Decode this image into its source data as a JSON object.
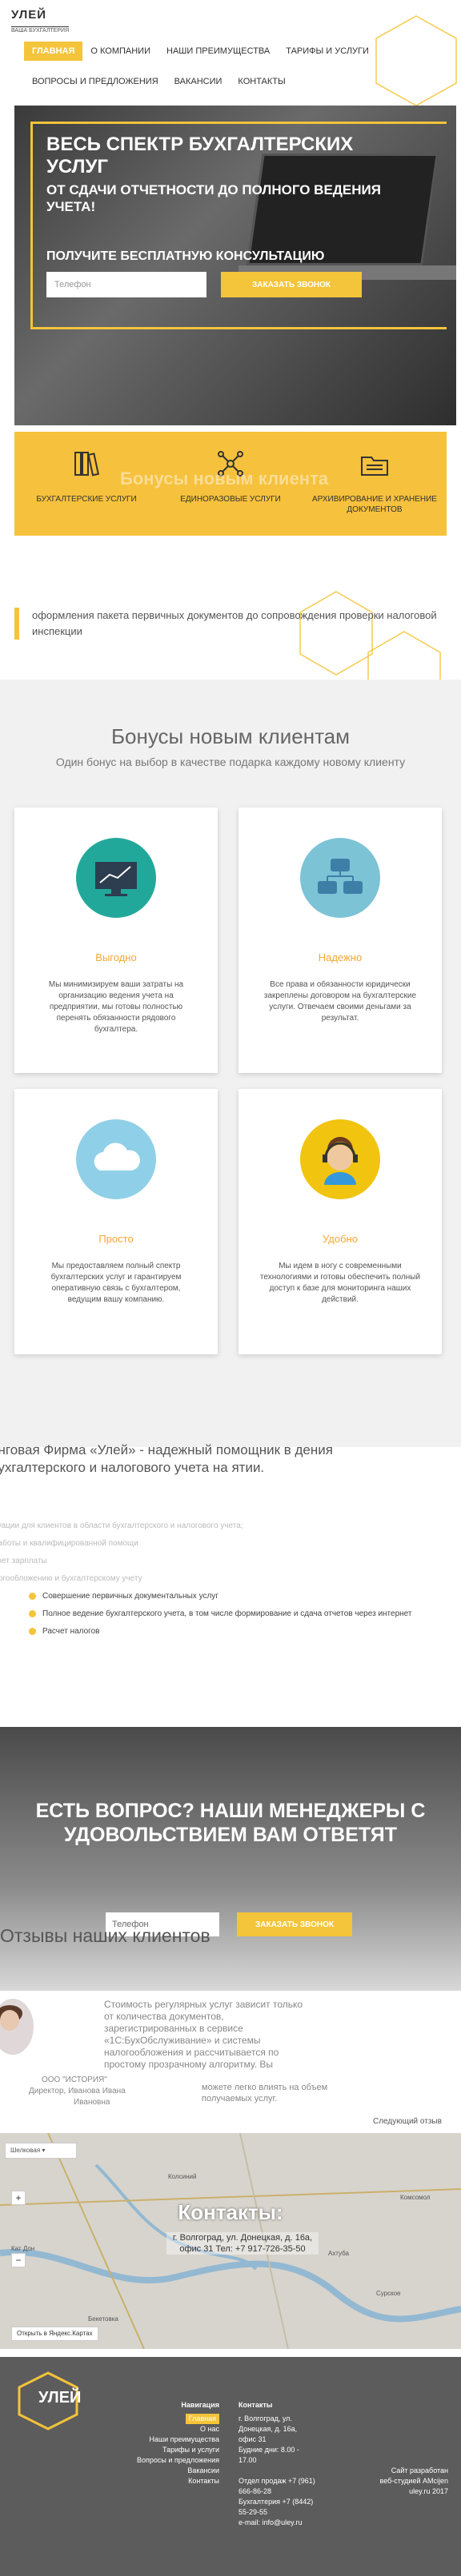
{
  "header": {
    "logo_title": "УЛЕЙ",
    "logo_sub": "ВАША БУХГАЛТЕРИЯ",
    "nav_row1": [
      "ГЛАВНАЯ",
      "О КОМПАНИИ",
      "НАШИ ПРЕИМУЩЕСТВА",
      "ТАРИФЫ И УСЛУГИ"
    ],
    "nav_row2": [
      "ВОПРОСЫ И ПРЕДЛОЖЕНИЯ",
      "ВАКАНСИИ",
      "КОНТАКТЫ"
    ]
  },
  "hero": {
    "title": "ВЕСЬ СПЕКТР БУХГАЛТЕРСКИХ УСЛУГ",
    "subtitle": "ОТ СДАЧИ ОТЧЕТНОСТИ ДО ПОЛНОГО ВЕДЕНИЯ УЧЕТА!",
    "cta": "ПОЛУЧИТЕ БЕСПЛАТНУЮ КОНСУЛЬТАЦИЮ",
    "phone_placeholder": "Телефон",
    "button": "ЗАКАЗАТЬ ЗВОНОК"
  },
  "services": {
    "ghost_title": "Бонусы новым клиента",
    "items": [
      "БУХГАЛТЕРСКИЕ УСЛУГИ",
      "ЕДИНОРАЗОВЫЕ УСЛУГИ",
      "АРХИВИРОВАНИЕ И ХРАНЕНИЕ ДОКУМЕНТОВ"
    ]
  },
  "quote": "оформления пакета первичных документов до сопровождения проверки налоговой инспекции",
  "bonuses": {
    "title": "Бонусы новым клиентам",
    "subtitle": "Один бонус на выбор в качестве подарка каждому новому клиенту",
    "cards": [
      {
        "title": "Выгодно",
        "text": "Мы минимизируем ваши затраты на организацию ведения учета на предприятии, мы готовы полностью перенять обязанности рядового бухгалтера."
      },
      {
        "title": "Надежно",
        "text": "Все права и обязанности юридически закреплены договором на бухгалтерские услуги. Отвечаем своими деньгами за результат."
      },
      {
        "title": "Просто",
        "text": "Мы предоставляем полный спектр бухгалтерских услуг и гарантируем оперативную связь с бухгалтером, ведущим вашу компанию."
      },
      {
        "title": "Удобно",
        "text": "Мы идем в ногу с современными технологиями и готовы обеспечить полный доступ к базе для мониторинга наших действий."
      }
    ]
  },
  "about": {
    "title": "инговая Фирма «Улей» - надежный помощник в дения бухгалтерского и налогового учета на ятии.",
    "faded": [
      "туации для клиентов в области бухгалтерского и налогового учета;",
      "работы и квалифицированной помощи",
      "счет зарплаты",
      "логообложению и бухгалтерскому учету"
    ],
    "items": [
      "Совершение первичных документальных услуг",
      "Полное ведение бухгалтерского учета, в том числе формирование и сдача отчетов через интернет",
      "Расчет налогов"
    ]
  },
  "question": {
    "title": "ЕСТЬ ВОПРОС? НАШИ МЕНЕДЖЕРЫ С УДОВОЛЬСТВИЕМ ВАМ ОТВЕТЯТ",
    "phone_placeholder": "Телефон",
    "button": "ЗАКАЗАТЬ ЗВОНОК"
  },
  "reviews": {
    "title": "Отзывы наших клиентов",
    "text": "Стоимость регулярных услуг зависит только от количества документов, зарегистрированных в сервисе «1С:БухОбслуживание» и системы налогообложения и рассчитывается по простому прозрачному алгоритму. Вы",
    "text2": "можете легко влиять на объем получаемых услуг.",
    "name1": "ООО \"ИСТОРИЯ\"",
    "name2": "Директор, Иванова Ивана",
    "name3": "Ивановна",
    "next": "Следующий отзыв"
  },
  "map": {
    "title": "Контакты:",
    "address": "г. Волгоград, ул. Донецкая, д. 16а, офис 31 Тел: +7 917-726-35-50",
    "control": "Шелковая ▾",
    "yandex": "Открыть в Яндекс.Картах",
    "towns": [
      "Колсиний",
      "Комсомол",
      "Ахтуба",
      "Сурское",
      "Бекетовка",
      "Кат Дон"
    ]
  },
  "footer": {
    "logo": "УЛЕЙ",
    "nav_title": "Навигация",
    "nav_items": [
      "Главная",
      "О нас",
      "Наши преимущества",
      "Тарифы и услуги",
      "Вопросы и предложения",
      "Вакансии",
      "Контакты"
    ],
    "contacts_title": "Контакты",
    "contacts": [
      "г. Волгоград, ул.",
      "Донецкая, д. 16а,",
      "офис 31",
      "Будние дни: 8.00 -",
      "17.00",
      "",
      "Отдел продаж +7 (961)",
      "666-86-28",
      "Бухгалтерия +7 (8442)",
      "55-29-55",
      "e-mail: info@uley.ru"
    ],
    "dev": [
      "Сайт разработан",
      "веб-студией AMcijen",
      "uley.ru 2017"
    ]
  },
  "colors": {
    "accent": "#f4c43a",
    "footer_bg": "#5c5c5c"
  }
}
